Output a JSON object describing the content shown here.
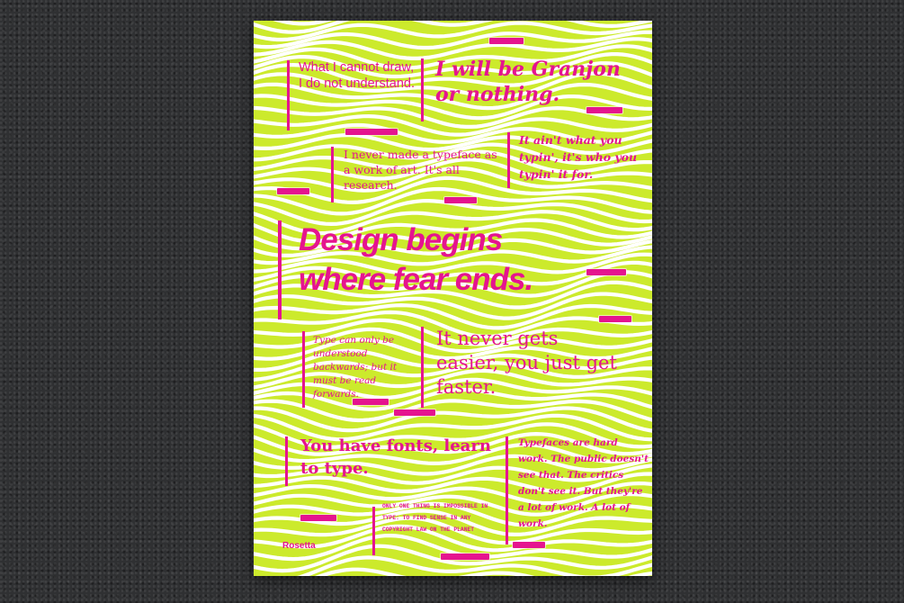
{
  "poster": {
    "colors": {
      "background": "#ccea2c",
      "waves": "#ffffff",
      "ink": "#e5148f",
      "backdrop": "#2f3032"
    },
    "quotes": [
      {
        "text": "What I cannot draw, I do not understand."
      },
      {
        "text": "I will be Granjon or nothing."
      },
      {
        "text": "I never made a typeface as a work of art. It's all research."
      },
      {
        "text": "It ain't what you typin', it's who you typin' it for."
      },
      {
        "text": "Design begins where fear ends."
      },
      {
        "text": "Type can only be understood backwards; but it must be read forwards."
      },
      {
        "text": "It never gets easier, you just get faster."
      },
      {
        "text": "You have fonts, learn to type."
      },
      {
        "text": "Typefaces are hard work. The public doesn't see that. The critics don't see it. But they're a lot of work. A lot of work."
      },
      {
        "text": "ONLY ONE THING IS IMPOSSIBLE IN TYPE: TO FIND SENSE IN ANY COPYRIGHT LAW ON THE PLANET"
      }
    ],
    "brand": "Rosetta"
  }
}
